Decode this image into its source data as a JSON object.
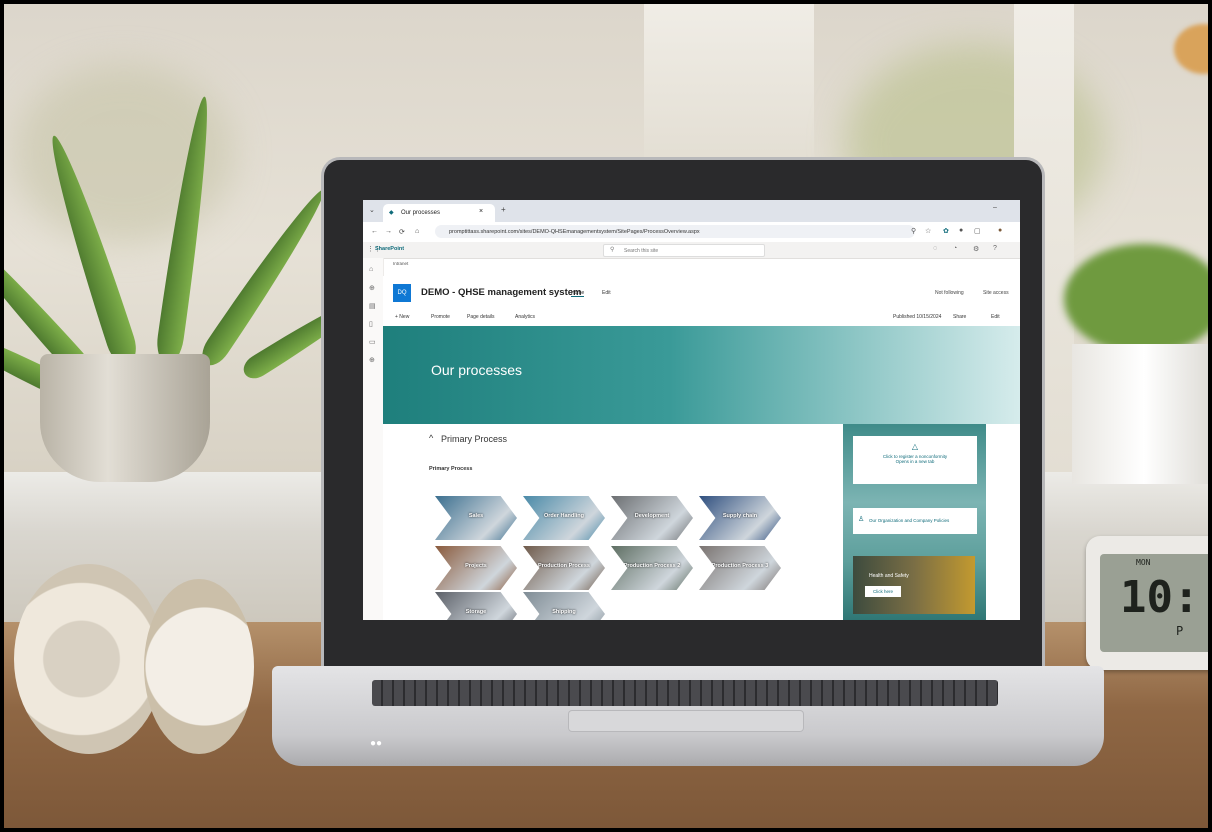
{
  "browser": {
    "tab_title": "Our processes",
    "tab_close": "×",
    "tab_new": "+",
    "url": "promptittass.sharepoint.com/sites/DEMO-QHSEmanagementsystem/SitePages/ProcessOverview.aspx"
  },
  "sharepoint": {
    "brand": "SharePoint",
    "search_placeholder": "Search this site",
    "breadcrumb": "Intranet",
    "site_logo": "DQ",
    "site_title": "DEMO - QHSE management system",
    "nav": [
      "Home",
      "Edit"
    ],
    "follow_label": "Not following",
    "share_site_label": "Site access"
  },
  "command_bar": {
    "new": "+ New",
    "promote": "Promote",
    "page_details": "Page details",
    "analytics": "Analytics",
    "published": "Published 10/15/2024",
    "share": "Share",
    "edit": "Edit"
  },
  "page": {
    "banner_title": "Our processes",
    "section_title": "Primary Process",
    "section_subtitle": "Primary Process",
    "processes": [
      {
        "label": "Sales",
        "color": "#3b6f8f"
      },
      {
        "label": "Order Handling",
        "color": "#4a8aa8"
      },
      {
        "label": "Development",
        "color": "#6c6f72"
      },
      {
        "label": "Supply chain",
        "color": "#2f4f7f"
      },
      {
        "label": "Projects",
        "color": "#8a5a3c"
      },
      {
        "label": "Production Process",
        "color": "#6f5a4a"
      },
      {
        "label": "Production Process 2",
        "color": "#5e6e62"
      },
      {
        "label": "Production Process 3",
        "color": "#7a7370"
      },
      {
        "label": "Storage",
        "color": "#5c6068"
      },
      {
        "label": "Shipping",
        "color": "#7f8c95"
      }
    ]
  },
  "sidebar": {
    "nonconformity_line1": "Click to register a nonconformity",
    "nonconformity_line2": "Opens in a new tab",
    "org_link": "Our Organization and Company Policies",
    "hs_title": "Health and Safety",
    "hs_button": "Click here"
  },
  "clock": {
    "label": "MON",
    "time": "10:",
    "ampm": "P"
  }
}
